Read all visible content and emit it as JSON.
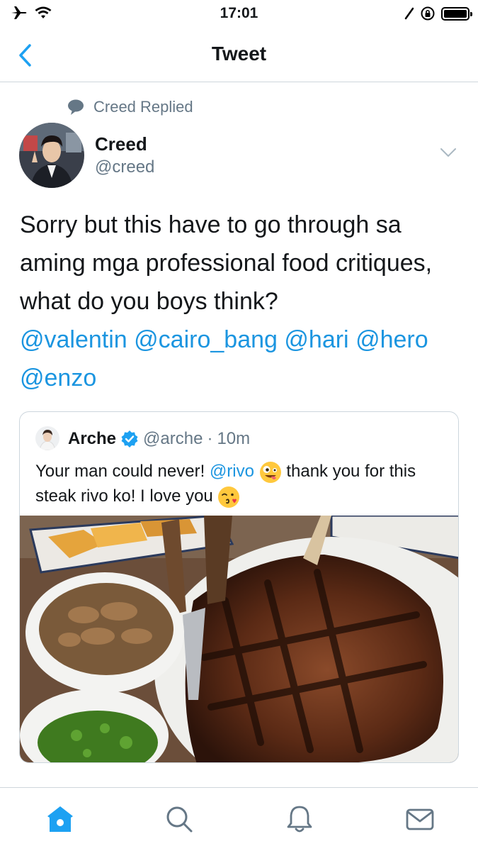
{
  "status_bar": {
    "time": "17:01"
  },
  "nav": {
    "title": "Tweet"
  },
  "tweet": {
    "context_label": "Creed Replied",
    "author_name": "Creed",
    "author_handle": "@creed",
    "body_text": "Sorry but this have to go through sa aming mga professional food critiques, what do you boys think?",
    "mentions": [
      "@valentin",
      "@cairo_bang",
      "@hari",
      "@hero",
      "@enzo"
    ]
  },
  "quoted_tweet": {
    "author_name": "Arche",
    "verified": true,
    "author_handle": "@arche",
    "separator": "·",
    "time": "10m",
    "text_part1": "Your man could never! ",
    "mention": "@rivo",
    "text_part2": " thank you for this steak rivo ko! I love you ",
    "emoji_1": "zany-face",
    "emoji_2": "face-blowing-kiss",
    "image_description_icon": "steak-photo"
  },
  "tab_bar": {
    "tabs": [
      "home-icon",
      "search-icon",
      "notifications-icon",
      "messages-icon"
    ],
    "active_tab": "home"
  },
  "colors": {
    "accent": "#1da1f2",
    "link": "#1b95e0",
    "secondary_text": "#657786",
    "border": "#cfd6dc"
  }
}
